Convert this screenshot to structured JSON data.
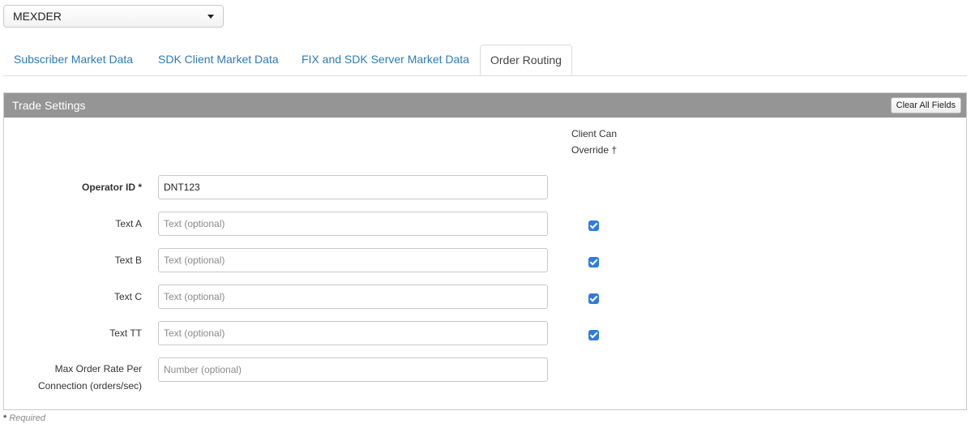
{
  "exchange_select": {
    "value": "MEXDER"
  },
  "tabs": [
    {
      "label": "Subscriber Market Data",
      "active": false
    },
    {
      "label": "SDK Client Market Data",
      "active": false
    },
    {
      "label": "FIX and SDK Server Market Data",
      "active": false
    },
    {
      "label": "Order Routing",
      "active": true
    }
  ],
  "panel": {
    "title": "Trade Settings",
    "clear_button": "Clear All Fields",
    "column_header_line1": "Client Can",
    "column_header_line2": "Override †",
    "rows": [
      {
        "label": "Operator ID *",
        "value": "DNT123",
        "placeholder": "",
        "override_checked": null
      },
      {
        "label": "Text A",
        "value": "",
        "placeholder": "Text (optional)",
        "override_checked": true
      },
      {
        "label": "Text B",
        "value": "",
        "placeholder": "Text (optional)",
        "override_checked": true
      },
      {
        "label": "Text C",
        "value": "",
        "placeholder": "Text (optional)",
        "override_checked": true
      },
      {
        "label": "Text TT",
        "value": "",
        "placeholder": "Text (optional)",
        "override_checked": true
      },
      {
        "label_line1": "Max Order Rate Per",
        "label_line2": "Connection (orders/sec)",
        "value": "",
        "placeholder": "Number (optional)",
        "override_checked": null
      }
    ]
  },
  "footer": {
    "required_star": "*",
    "required_text": "Required"
  },
  "colors": {
    "link": "#2e7bb8",
    "header_bg": "#959595",
    "checkbox": "#2f7be0"
  }
}
